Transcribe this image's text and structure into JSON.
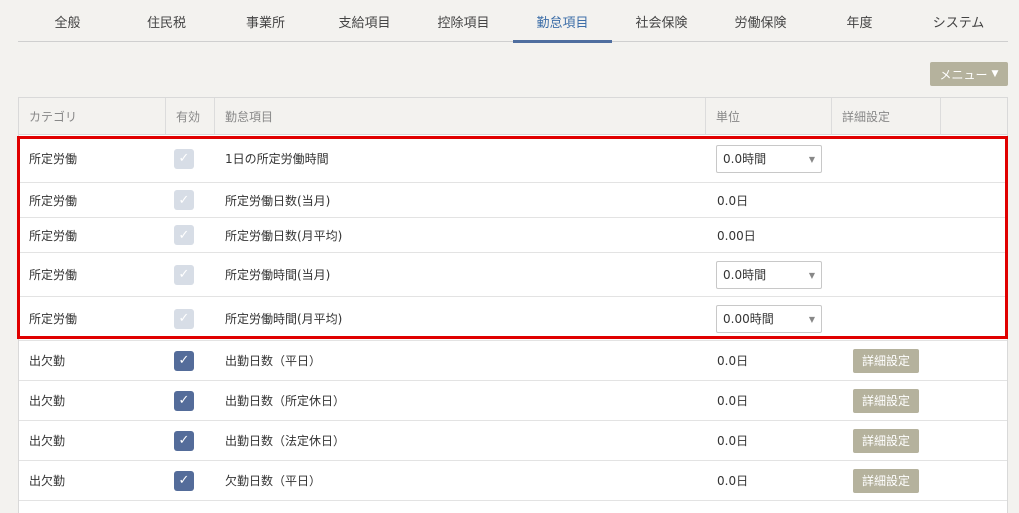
{
  "tabs": [
    {
      "label": "全般",
      "active": false
    },
    {
      "label": "住民税",
      "active": false
    },
    {
      "label": "事業所",
      "active": false
    },
    {
      "label": "支給項目",
      "active": false
    },
    {
      "label": "控除項目",
      "active": false
    },
    {
      "label": "勤怠項目",
      "active": true
    },
    {
      "label": "社会保険",
      "active": false
    },
    {
      "label": "労働保険",
      "active": false
    },
    {
      "label": "年度",
      "active": false
    },
    {
      "label": "システム",
      "active": false
    }
  ],
  "menu_button": {
    "label": "メニュー",
    "icon": "caret-down-icon"
  },
  "table": {
    "headers": {
      "category": "カテゴリ",
      "enabled": "有効",
      "item": "勤怠項目",
      "unit": "単位",
      "detail": "詳細設定"
    },
    "rows": [
      {
        "category": "所定労働",
        "checked": true,
        "disabled": true,
        "item": "1日の所定労働時間",
        "unit": "0.0時間",
        "unit_select": true,
        "detail": ""
      },
      {
        "category": "所定労働",
        "checked": true,
        "disabled": true,
        "item": "所定労働日数(当月)",
        "unit": "0.0日",
        "unit_select": false,
        "detail": ""
      },
      {
        "category": "所定労働",
        "checked": true,
        "disabled": true,
        "item": "所定労働日数(月平均)",
        "unit": "0.00日",
        "unit_select": false,
        "detail": ""
      },
      {
        "category": "所定労働",
        "checked": true,
        "disabled": true,
        "item": "所定労働時間(当月)",
        "unit": "0.0時間",
        "unit_select": true,
        "detail": ""
      },
      {
        "category": "所定労働",
        "checked": true,
        "disabled": true,
        "item": "所定労働時間(月平均)",
        "unit": "0.00時間",
        "unit_select": true,
        "detail": ""
      },
      {
        "category": "出欠勤",
        "checked": true,
        "disabled": false,
        "item": "出勤日数（平日）",
        "unit": "0.0日",
        "unit_select": false,
        "detail": "詳細設定"
      },
      {
        "category": "出欠勤",
        "checked": true,
        "disabled": false,
        "item": "出勤日数（所定休日）",
        "unit": "0.0日",
        "unit_select": false,
        "detail": "詳細設定"
      },
      {
        "category": "出欠勤",
        "checked": true,
        "disabled": false,
        "item": "出勤日数（法定休日）",
        "unit": "0.0日",
        "unit_select": false,
        "detail": "詳細設定"
      },
      {
        "category": "出欠勤",
        "checked": true,
        "disabled": false,
        "item": "欠勤日数（平日）",
        "unit": "0.0日",
        "unit_select": false,
        "detail": "詳細設定"
      }
    ]
  },
  "colors": {
    "accent": "#4f6e9f",
    "button": "#b5b29d",
    "highlight": "#e00000"
  }
}
